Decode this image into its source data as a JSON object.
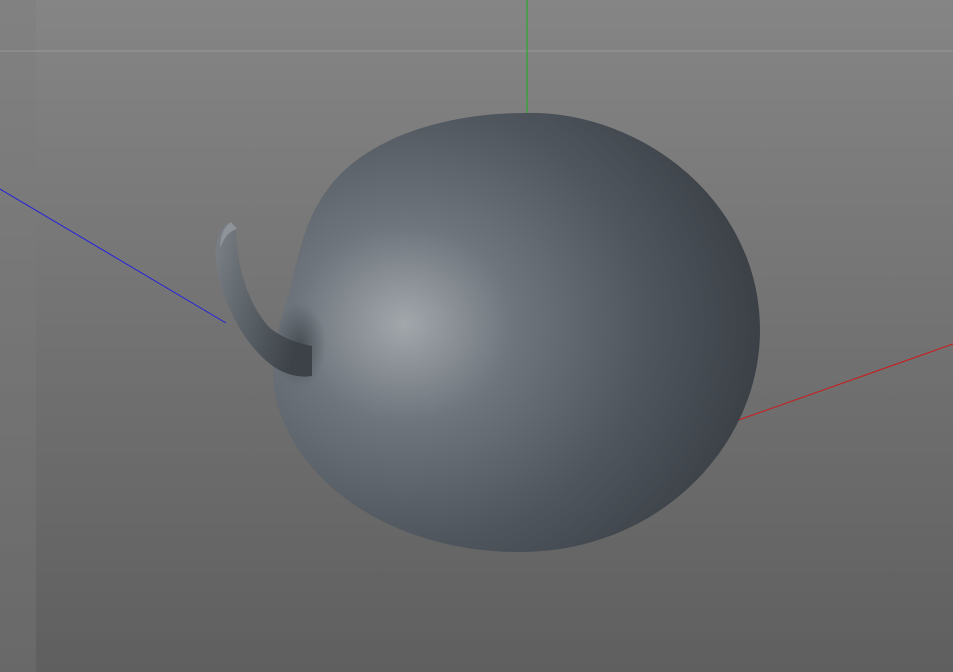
{
  "viewport": {
    "background_top": "#858585",
    "background_bottom": "#5f5f5f",
    "horizon_color": "#9a9a9a",
    "left_strip_color": "#7a7a7a"
  },
  "axes": {
    "x": {
      "name": "x-axis",
      "color": "#d01818"
    },
    "y": {
      "name": "y-axis",
      "color": "#18b018"
    },
    "z": {
      "name": "z-axis",
      "color": "#2222dd"
    }
  },
  "object": {
    "name": "apple-mesh",
    "base_color": "#4f565d",
    "highlight_color": "#a2a7ac",
    "shadow_color": "#353a40"
  }
}
